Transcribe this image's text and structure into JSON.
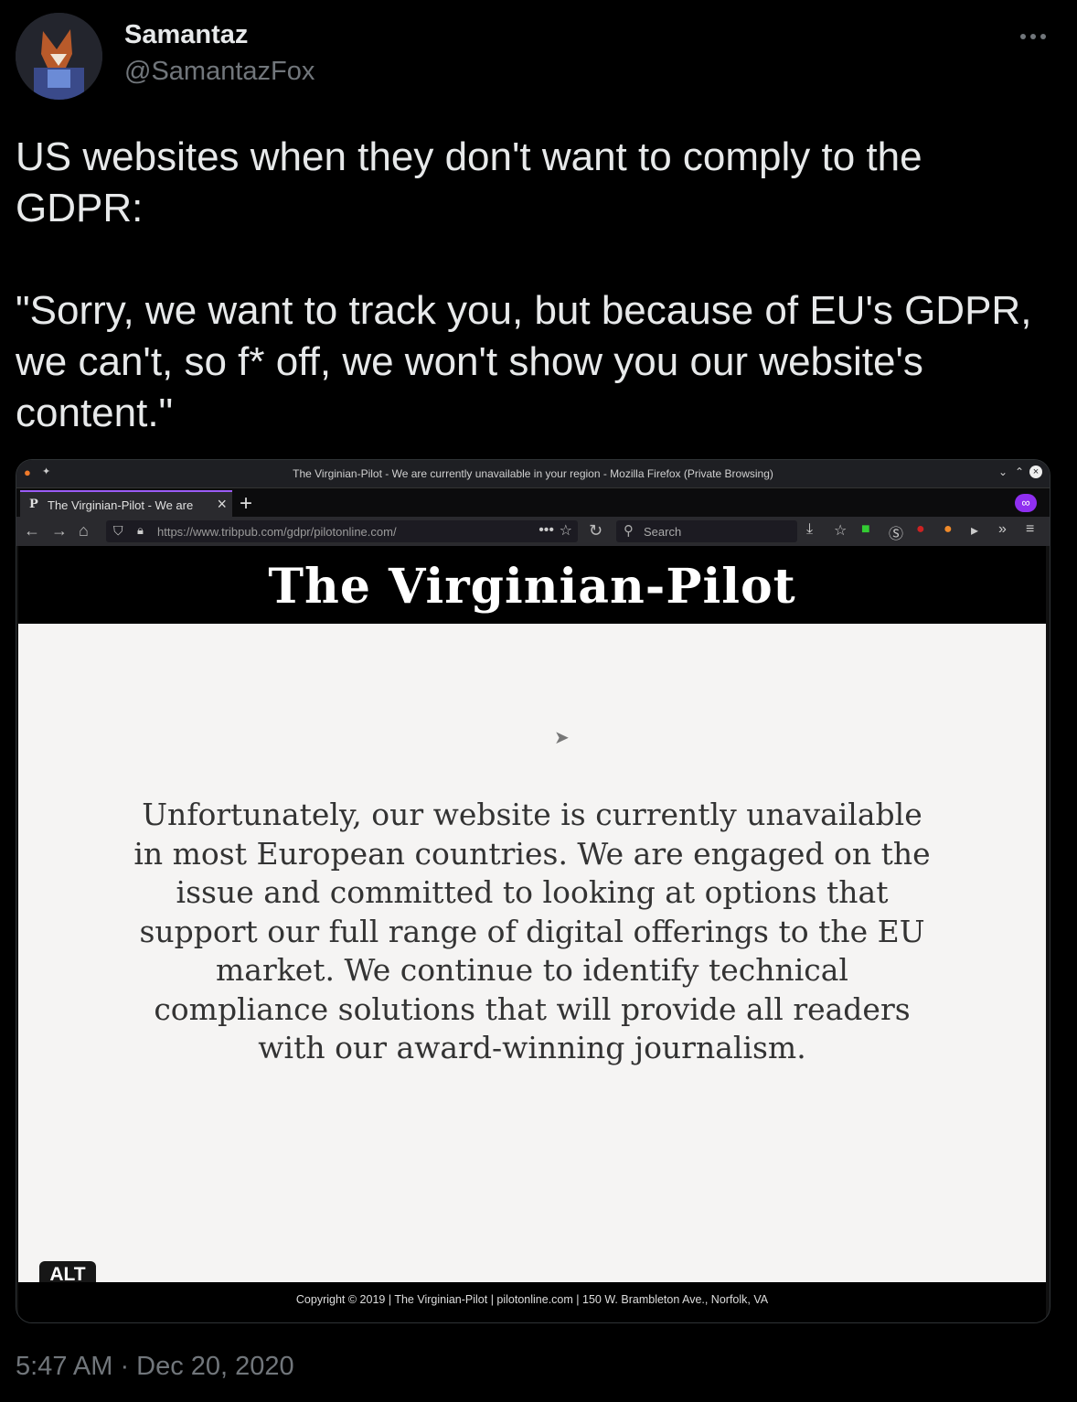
{
  "tweet": {
    "display_name": "Samantaz",
    "handle": "@SamantazFox",
    "text": "US websites when they don't want to comply to the GDPR:\n\n\"Sorry, we want to track you, but because of EU's GDPR, we can't, so f* off, we won't show you our website's content.\"",
    "timestamp": "5:47 AM · Dec 20, 2020",
    "alt_badge": "ALT"
  },
  "screenshot": {
    "window_title": "The Virginian-Pilot - We are currently unavailable in your region - Mozilla Firefox (Private Browsing)",
    "tab_title": "The Virginian-Pilot - We are",
    "url": "https://www.tribpub.com/gdpr/pilotonline.com/",
    "search_placeholder": "Search",
    "masthead": "The Virginian-Pilot",
    "message": "Unfortunately, our website is currently unavailable in most European countries. We are engaged on the issue and committed to looking at options that support our full range of digital offerings to the EU market. We continue to identify technical compliance solutions that will provide all readers with our award-winning journalism.",
    "footer": "Copyright © 2019 | The Virginian-Pilot | pilotonline.com | 150 W. Brambleton Ave., Norfolk, VA"
  },
  "colors": {
    "background": "#000000",
    "text_primary": "#e7e9ea",
    "text_secondary": "#71767b",
    "private_browsing": "#8f2ff0"
  },
  "icons": [
    "more-icon",
    "firefox-icon",
    "close-icon",
    "back-icon",
    "forward-icon",
    "home-icon",
    "shield-icon",
    "lock-icon",
    "star-icon",
    "reload-icon",
    "search-icon",
    "download-icon",
    "private-mask-icon",
    "cursor-icon"
  ]
}
